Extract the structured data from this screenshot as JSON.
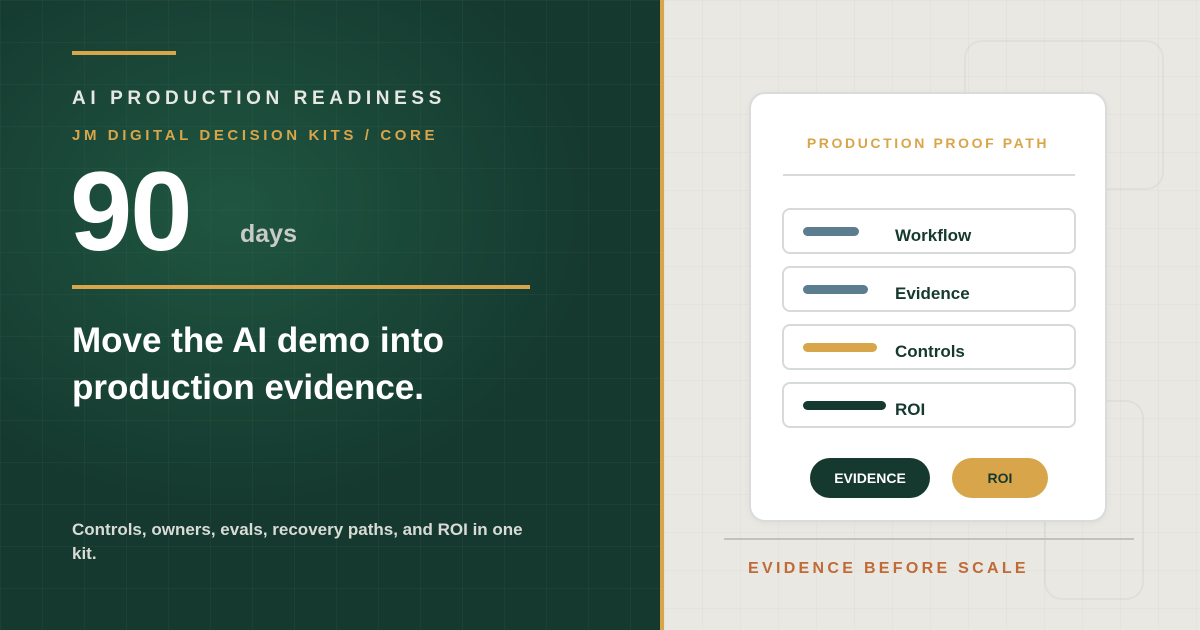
{
  "left": {
    "eyebrow": "AI PRODUCTION READINESS",
    "subeyebrow": "JM DIGITAL DECISION KITS / CORE",
    "big_number": "90",
    "unit": "days",
    "headline": "Move the AI demo into production evidence.",
    "body": "Controls, owners, evals, recovery paths, and ROI in one kit."
  },
  "card": {
    "title": "PRODUCTION PROOF PATH",
    "rows": [
      {
        "label": "Workflow",
        "bar_color": "#5c7d8f"
      },
      {
        "label": "Evidence",
        "bar_color": "#5c7d8f"
      },
      {
        "label": "Controls",
        "bar_color": "#d9a54a"
      },
      {
        "label": "ROI",
        "bar_color": "#15392f"
      }
    ],
    "pill_primary": "EVIDENCE",
    "pill_secondary": "ROI"
  },
  "footer": "EVIDENCE BEFORE SCALE",
  "colors": {
    "forest": "#15392f",
    "gold": "#d9a54a",
    "slate": "#5c7d8f",
    "rust": "#c06a38"
  }
}
